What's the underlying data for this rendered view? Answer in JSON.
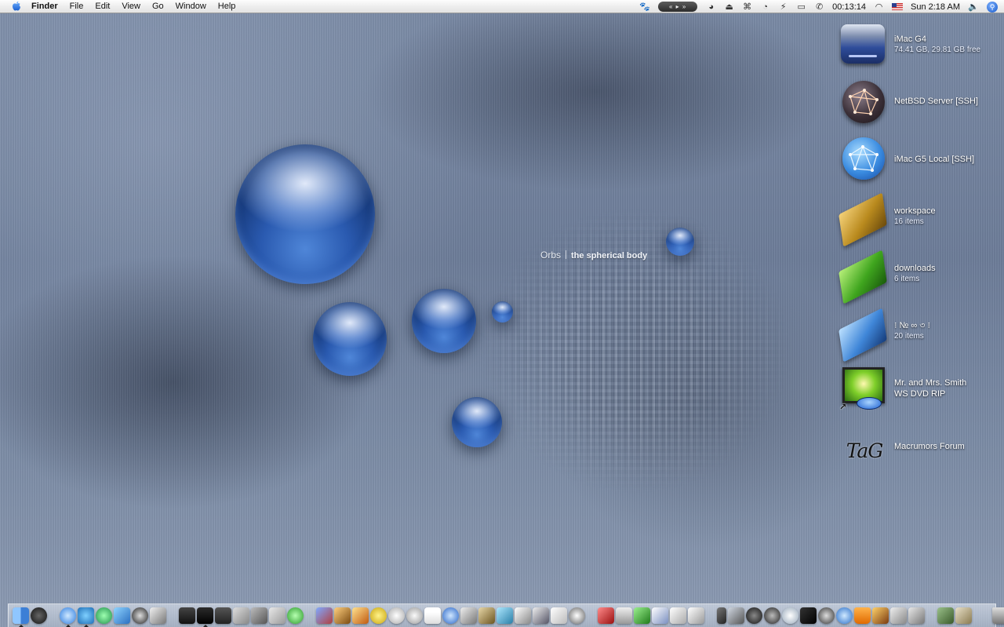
{
  "menubar": {
    "app_name": "Finder",
    "menus": [
      "File",
      "Edit",
      "View",
      "Go",
      "Window",
      "Help"
    ],
    "itunes_controls": "« ▸ »",
    "timer": "00:13:14",
    "clock": "Sun 2:18 AM"
  },
  "wallpaper": {
    "title": "Orbs",
    "subtitle": "the spherical body"
  },
  "desktop_items": [
    {
      "name": "iMac G4",
      "detail": "74.41 GB, 29.81 GB free",
      "icon": "hard-drive-icon"
    },
    {
      "name": "NetBSD Server [SSH]",
      "detail": "",
      "icon": "network-server-icon"
    },
    {
      "name": "iMac G5 Local [SSH]",
      "detail": "",
      "icon": "network-server-icon"
    },
    {
      "name": "workspace",
      "detail": "16 items",
      "icon": "folder-icon"
    },
    {
      "name": "downloads",
      "detail": "6 items",
      "icon": "folder-icon"
    },
    {
      "name": "⁝ № ∞ ৩ ⁝",
      "detail": "20 items",
      "icon": "folder-icon"
    },
    {
      "name": "Mr. and Mrs. Smith",
      "detail": "WS DVD RIP",
      "icon": "dvd-alias-icon"
    },
    {
      "name": "Macrumors Forum",
      "detail": "",
      "icon": "web-location-icon",
      "logo_text": "TaG"
    }
  ],
  "colors": {
    "wallpaper_base": "#6f7f98",
    "orb_blue": "#2a5ab0"
  }
}
